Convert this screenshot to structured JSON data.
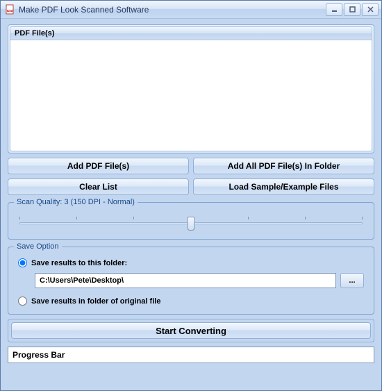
{
  "window": {
    "title": "Make PDF Look Scanned Software"
  },
  "file_panel": {
    "header": "PDF File(s)"
  },
  "buttons": {
    "add": "Add PDF File(s)",
    "add_folder": "Add All PDF File(s) In Folder",
    "clear": "Clear List",
    "load_sample": "Load Sample/Example Files",
    "browse": "...",
    "start": "Start Converting"
  },
  "scan_quality": {
    "label": "Scan Quality: 3 (150 DPI - Normal)",
    "value": 3,
    "min": 0,
    "max": 6,
    "thumb_percent": 50
  },
  "save_option": {
    "label": "Save Option",
    "radio_folder": "Save results to this folder:",
    "radio_original": "Save results in folder of original file",
    "selected": "folder",
    "folder_path": "C:\\Users\\Pete\\Desktop\\"
  },
  "progress": {
    "label": "Progress Bar"
  }
}
